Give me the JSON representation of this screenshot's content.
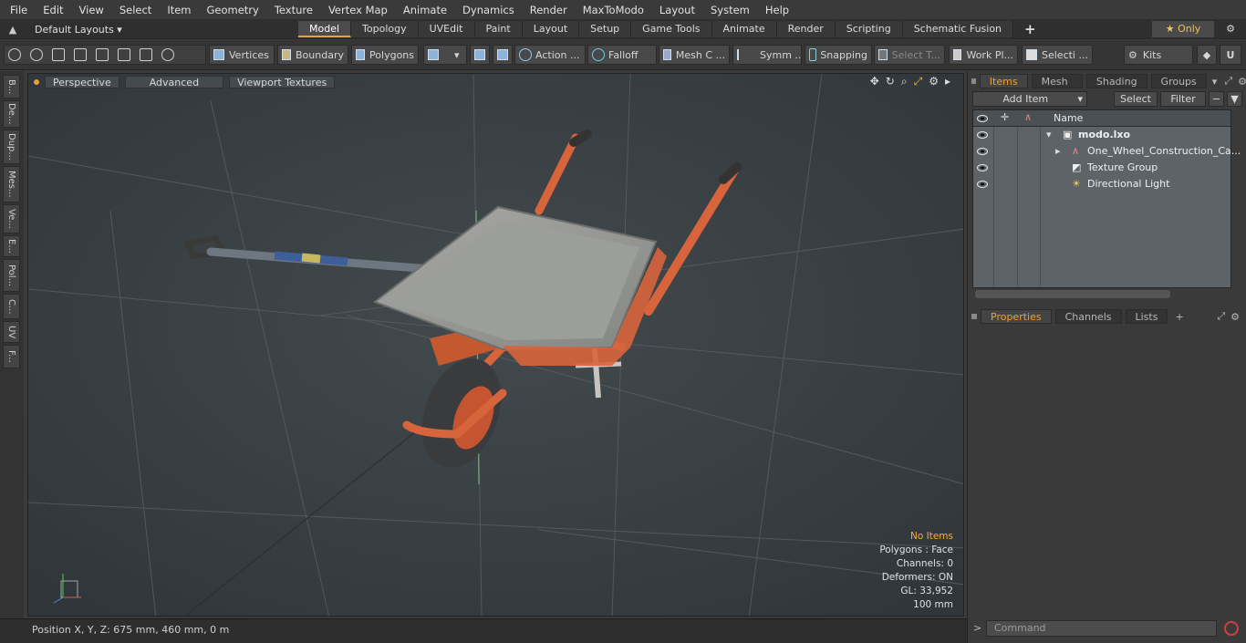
{
  "menu": [
    "File",
    "Edit",
    "View",
    "Select",
    "Item",
    "Geometry",
    "Texture",
    "Vertex Map",
    "Animate",
    "Dynamics",
    "Render",
    "MaxToModo",
    "Layout",
    "System",
    "Help"
  ],
  "layouts": {
    "label": "Default Layouts ▾"
  },
  "mode_tabs": [
    "Model",
    "Topology",
    "UVEdit",
    "Paint",
    "Layout",
    "Setup",
    "Game Tools",
    "Animate",
    "Render",
    "Scripting",
    "Schematic Fusion"
  ],
  "active_mode": "Model",
  "only_label": "★ Only",
  "toolbar": {
    "vertices": "Vertices",
    "boundary": "Boundary",
    "polygons": "Polygons",
    "action": "Action ...",
    "falloff": "Falloff",
    "mesh": "Mesh C ...",
    "symm": "Symm ...",
    "snapping": "Snapping",
    "select_t": "Select T...",
    "work_pl": "Work Pl...",
    "selecti": "Selecti ...",
    "kits": "Kits"
  },
  "side_tabs": [
    "B...",
    "De...",
    "Dup...",
    "Mes...",
    "Ve...",
    "E...",
    "Pol...",
    "C...",
    "UV",
    "F..."
  ],
  "viewport": {
    "perspective": "Perspective",
    "advanced": "Advanced",
    "textures": "Viewport Textures",
    "info": {
      "no_items": "No Items",
      "polygons": "Polygons : Face",
      "channels": "Channels: 0",
      "deformers": "Deformers: ON",
      "gl": "GL: 33,952",
      "scale": "100 mm"
    }
  },
  "status": "Position X, Y, Z:   675 mm, 460 mm, 0 m",
  "panel_tabs_top": [
    "Items",
    "Mesh ...",
    "Shading",
    "Groups"
  ],
  "add_item": "Add Item",
  "select_btn": "Select",
  "filter_btn": "Filter",
  "items_header": "Name",
  "items": [
    {
      "name": "modo.lxo"
    },
    {
      "name": "One_Wheel_Construction_Ca..."
    },
    {
      "name": "Texture Group"
    },
    {
      "name": "Directional Light"
    }
  ],
  "panel_tabs_bottom": [
    "Properties",
    "Channels",
    "Lists"
  ],
  "command_placeholder": "Command",
  "colors": {
    "accent": "#e3a340",
    "wheelbarrow": "#d8643c"
  }
}
